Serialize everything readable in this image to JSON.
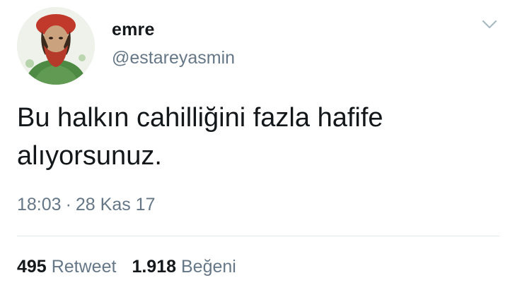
{
  "tweet": {
    "author": {
      "display_name": "emre",
      "handle": "@estareyasmin"
    },
    "text": "Bu halkın cahilliğini fazla hafife\nalıyorsunuz.",
    "time": "18:03",
    "separator": "·",
    "date": "28 Kas 17",
    "stats": {
      "retweet_count": "495",
      "retweet_label": "Retweet",
      "like_count": "1.918",
      "like_label": "Beğeni"
    }
  },
  "icons": {
    "more": "chevron-down-icon"
  },
  "colors": {
    "text": "#14171a",
    "secondary": "#657786",
    "divider": "#e1e8ed"
  }
}
